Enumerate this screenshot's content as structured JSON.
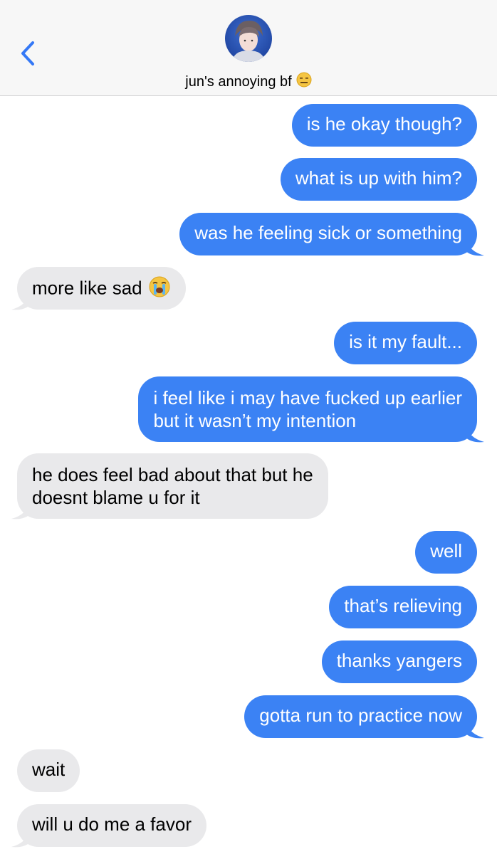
{
  "header": {
    "contact_name": "jun's annoying bf",
    "contact_emoji": "expressionless-face-emoji",
    "back_icon": "chevron-left-icon",
    "avatar": "contact-photo"
  },
  "colors": {
    "sent_bubble": "#3b82f4",
    "received_bubble": "#e9e9eb",
    "accent": "#3478f6"
  },
  "messages": [
    {
      "dir": "sent",
      "text": "is he okay though?"
    },
    {
      "dir": "sent",
      "text": "what is up with him?"
    },
    {
      "dir": "sent",
      "text": "was he feeling sick or something"
    },
    {
      "dir": "received",
      "text": "more like sad",
      "emoji": "loudly-crying-face-emoji"
    },
    {
      "dir": "sent",
      "text": "is it my fault..."
    },
    {
      "dir": "sent",
      "text_line1": "i feel like i may have fucked up earlier",
      "text_line2": "but it wasn’t my intention"
    },
    {
      "dir": "received",
      "text_line1": "he does feel bad about that but he",
      "text_line2": "doesnt blame u for it"
    },
    {
      "dir": "sent",
      "text": "well"
    },
    {
      "dir": "sent",
      "text": "that’s relieving"
    },
    {
      "dir": "sent",
      "text": "thanks yangers"
    },
    {
      "dir": "sent",
      "text": "gotta run to practice now"
    },
    {
      "dir": "received",
      "text": "wait"
    },
    {
      "dir": "received",
      "text": "will u do me a favor"
    }
  ]
}
